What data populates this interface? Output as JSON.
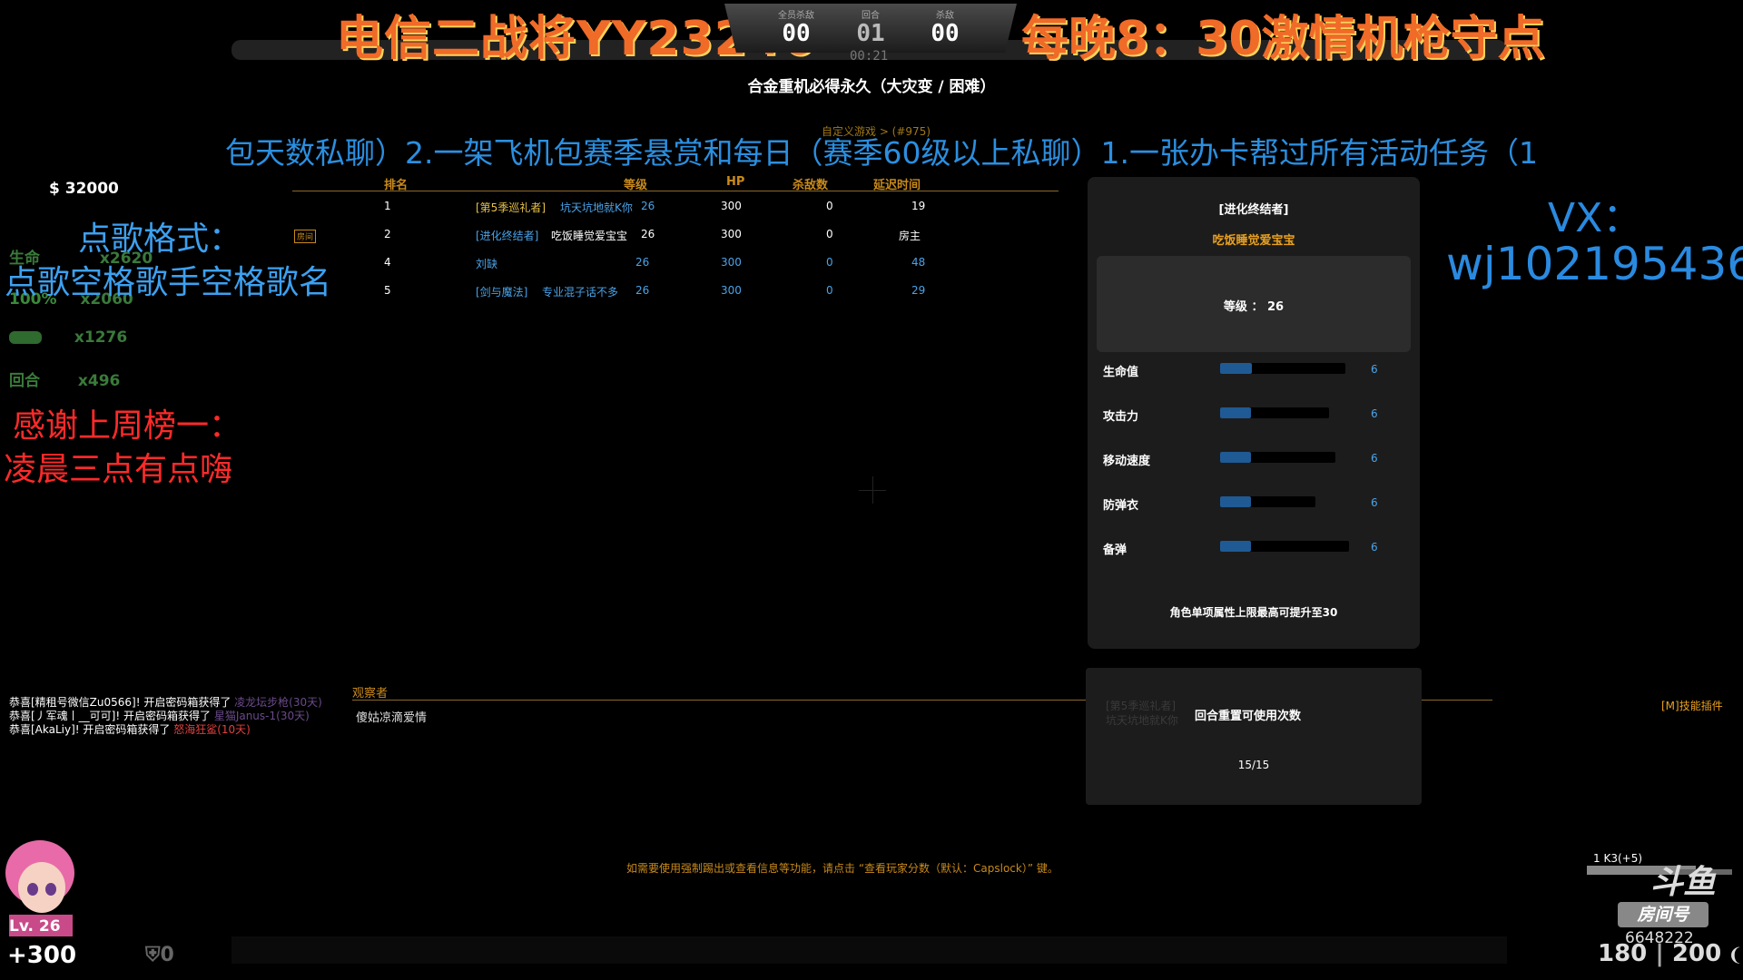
{
  "banner": {
    "left": "电信二战将YY23246",
    "right": "每晚8：30激情机枪守点"
  },
  "score": {
    "team_kills_label": "全员杀敌",
    "team_kills": "00",
    "round_label": "回合",
    "round": "01",
    "kills_label": "杀敌",
    "kills": "00",
    "timer": "00:21"
  },
  "map_title": "合金重机必得永久（大灾变 / 困难）",
  "breadcrumb": "自定义游戏 > (#975)",
  "scrolling_text": "包天数私聊）2.一架飞机包赛季悬赏和每日（赛季60级以上私聊）1.一张办卡帮过所有活动任务（1",
  "money": "$ 32000",
  "scoreboard": {
    "headers": {
      "rank": "排名",
      "level": "等级",
      "hp": "HP",
      "kills": "杀敌数",
      "ping": "延迟时间"
    },
    "rows": [
      {
        "rank": "1",
        "tag": "[第5季巡礼者]",
        "name": "坑天坑地就K你",
        "level": "26",
        "hp": "300",
        "kills": "0",
        "ping": "19",
        "badge": ""
      },
      {
        "rank": "2",
        "tag": "[进化终结者]",
        "name": "吃饭睡觉爱宝宝",
        "level": "26",
        "hp": "300",
        "kills": "0",
        "ping": "房主",
        "badge": "房间"
      },
      {
        "rank": "4",
        "tag": "",
        "name": "刘缺",
        "level": "26",
        "hp": "300",
        "kills": "0",
        "ping": "48",
        "badge": ""
      },
      {
        "rank": "5",
        "tag": "[剑与魔法]",
        "name": "专业混子话不多",
        "level": "26",
        "hp": "300",
        "kills": "0",
        "ping": "29",
        "badge": ""
      }
    ],
    "observer_label": "观察者",
    "observer": "傻姑凉滴爱情"
  },
  "left_overlay": {
    "request_title": "点歌格式：",
    "request_format": "点歌空格歌手空格歌名",
    "thanks_line1": "感谢上周榜一：",
    "thanks_line2": "凌晨三点有点嗨",
    "kill_counts": [
      "x2620",
      "x2060",
      "x1276",
      "x496"
    ],
    "kill_labels": [
      "生命",
      "100%",
      "",
      "回合"
    ]
  },
  "vx": {
    "line1": "VX：",
    "line2": "wj1021954365"
  },
  "chat": [
    {
      "text": "恭喜[精租号微信Zu0566]! 开启密码箱获得了 ",
      "item": "凌龙坛步枪(30天)"
    },
    {
      "text": "恭喜[丿军魂丨__可可]! 开启密码箱获得了 ",
      "item": "星猫Janus-1(30天)"
    },
    {
      "text": "恭喜[AkaLiy]! 开启密码箱获得了 ",
      "item": "怒海狂鲨(10天)"
    }
  ],
  "panel": {
    "title": "[进化终结者]",
    "name": "吃饭睡觉爱宝宝",
    "level": "等级 ： 26",
    "stats": [
      {
        "label": "生命值",
        "value": "6",
        "fill_fraction": 0.25
      },
      {
        "label": "攻击力",
        "value": "6",
        "fill_fraction": 0.28
      },
      {
        "label": "移动速度",
        "value": "6",
        "fill_fraction": 0.27
      },
      {
        "label": "防弹衣",
        "value": "6",
        "fill_fraction": 0.32
      },
      {
        "label": "备弹",
        "value": "6",
        "fill_fraction": 0.24
      }
    ],
    "note": "角色单项属性上限最高可提升至30"
  },
  "panel2": {
    "ghost_tag": "[第5季巡礼者]",
    "ghost_name": "坑天坑地就K你",
    "label": "回合重置可使用次数",
    "value": "15/15"
  },
  "skill_plugin": "[M]技能插件",
  "hint": "如需要使用强制踢出或查看信息等功能，请点击 “查看玩家分数（默认：Capslock）” 键。",
  "hud": {
    "level": "Lv. 26",
    "hp": "+300",
    "armor": "0",
    "ammo": "180",
    "ammo_reserve": "200",
    "weapon": "1 K3(+5)",
    "room_label": "房间号",
    "room_number": "6648222",
    "logo": "斗鱼"
  }
}
